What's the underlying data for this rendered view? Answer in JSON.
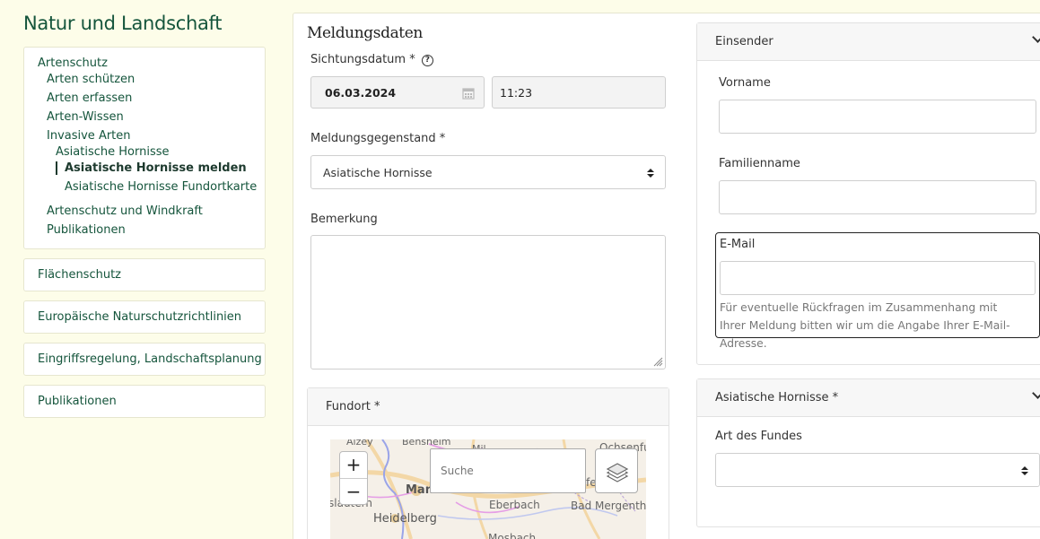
{
  "sidebar": {
    "title": "Natur und Landschaft",
    "items": [
      {
        "label": "Artenschutz"
      },
      {
        "label": "Arten schützen"
      },
      {
        "label": "Arten erfassen"
      },
      {
        "label": "Arten-Wissen"
      },
      {
        "label": "Invasive Arten"
      },
      {
        "label": "Asiatische Hornisse"
      },
      {
        "label": "Asiatische Hornisse melden"
      },
      {
        "label": "Asiatische Hornisse Fundortkarte"
      },
      {
        "label": "Artenschutz und Windkraft"
      },
      {
        "label": "Publikationen"
      }
    ],
    "categories": [
      {
        "label": "Flächenschutz"
      },
      {
        "label": "Europäische Naturschutzrichtlinien"
      },
      {
        "label": "Eingriffsregelung, Landschaftsplanung"
      },
      {
        "label": "Publikationen"
      }
    ]
  },
  "form": {
    "section_title": "Meldungsdaten",
    "date_label": "Sichtungsdatum *",
    "help_glyph": "?",
    "date_value": "06.03.2024",
    "time_value": "11:23",
    "subject_label": "Meldungsgegenstand *",
    "subject_value": "Asiatische Hornisse",
    "remark_label": "Bemerkung",
    "remark_value": ""
  },
  "fundort": {
    "title": "Fundort *",
    "zoom_in": "+",
    "zoom_out": "−",
    "search_placeholder": "Suche",
    "map_labels": {
      "alzey": "Alzey",
      "bensheim": "Bensheim",
      "mosbach_top": "Mil",
      "ochsenfurt": "Ochsenfu",
      "mannheim": "Man",
      "kaiserslautern": "slautern",
      "heidelberg": "Heidelberg",
      "eberbach": "Eberbach",
      "bad_mergentheim": "Bad Mergenthei",
      "wertheim_frag": "fe",
      "mosbach": "Mosbach"
    }
  },
  "einsender": {
    "title": "Einsender",
    "vorname_label": "Vorname",
    "familienname_label": "Familienname",
    "email_label": "E-Mail",
    "email_help": "Für eventuelle Rückfragen im Zusammenhang mit Ihrer Meldung bitten wir um die Angabe Ihrer E-Mail-Adresse."
  },
  "hornisse": {
    "title": "Asiatische Hornisse *",
    "art_label": "Art des Fundes",
    "art_value": ""
  },
  "colors": {
    "accent_green": "#15553c",
    "page_bg": "#fdfde9"
  }
}
